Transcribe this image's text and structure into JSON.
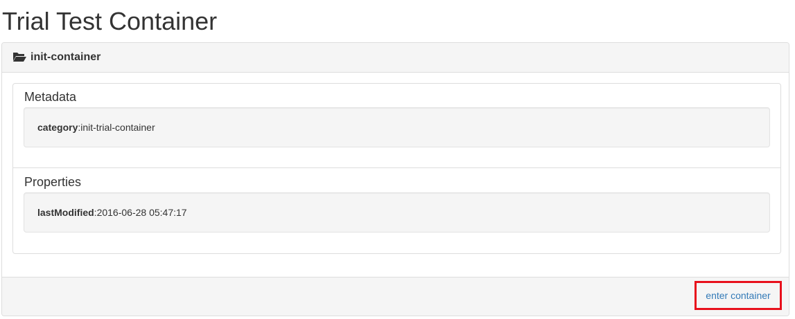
{
  "page": {
    "title": "Trial Test Container"
  },
  "panel": {
    "heading": {
      "icon": "folder-open-icon",
      "title": "init-container"
    },
    "metadata": {
      "title": "Metadata",
      "key": "category",
      "separator": ":",
      "value": "init-trial-container"
    },
    "properties": {
      "title": "Properties",
      "key": "lastModified",
      "separator": ":",
      "value": "2016-06-28 05:47:17"
    },
    "footer": {
      "link_label": "enter container",
      "highlight_color": "#e8101c",
      "link_color": "#337ab7"
    }
  }
}
